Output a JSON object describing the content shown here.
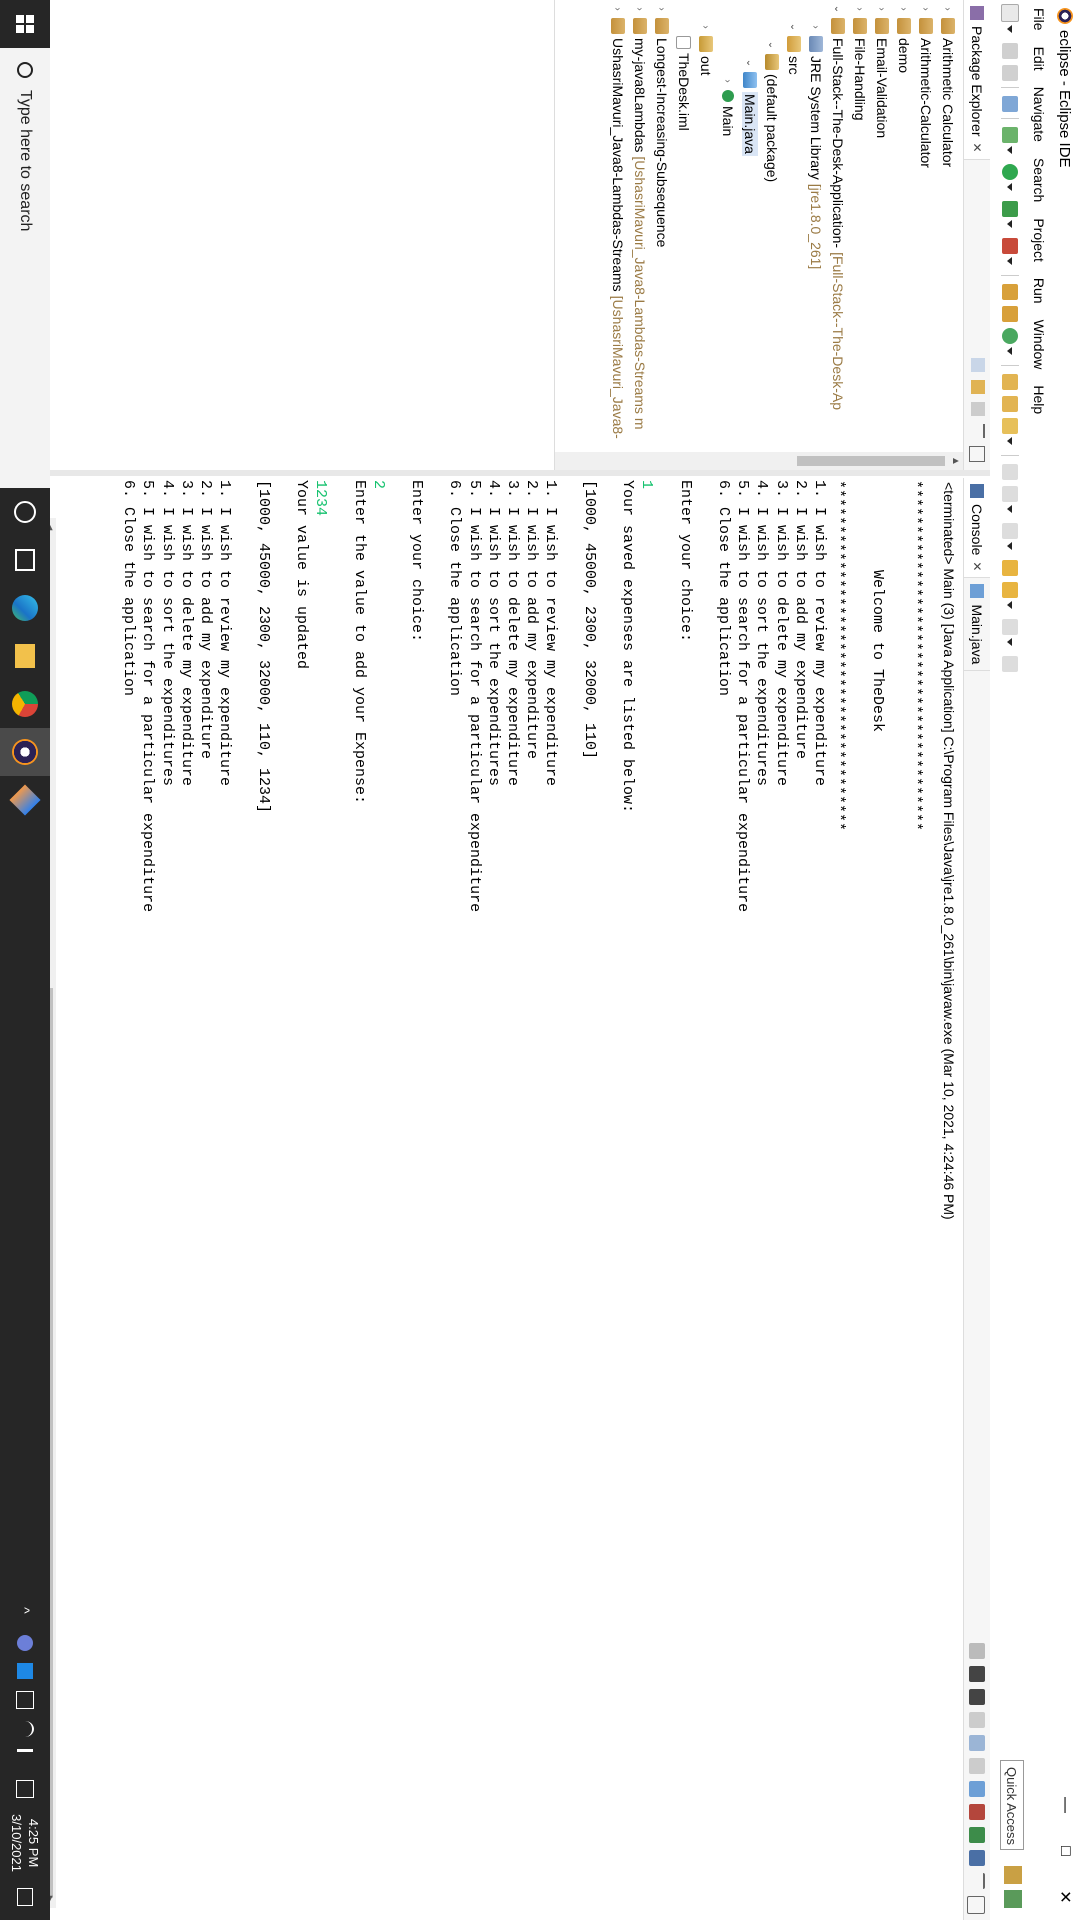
{
  "window": {
    "title": "eclipse - Eclipse IDE",
    "minimize": "—",
    "maximize": "□",
    "close": "✕"
  },
  "menu": [
    "File",
    "Edit",
    "Navigate",
    "Search",
    "Project",
    "Run",
    "Window",
    "Help"
  ],
  "toolbar": {
    "quick_access": "Quick Access"
  },
  "package_explorer": {
    "tab_label": "Package Explorer",
    "items": [
      {
        "label": "Arithmetic Calculator",
        "depth": 0,
        "icon": "project-icon"
      },
      {
        "label": "Arithmetic-Calculator",
        "depth": 0,
        "icon": "project-icon"
      },
      {
        "label": "demo",
        "depth": 0,
        "icon": "project-icon"
      },
      {
        "label": "Email-Validation",
        "depth": 0,
        "icon": "project-icon"
      },
      {
        "label": "File-Handling",
        "depth": 0,
        "icon": "project-icon"
      },
      {
        "label": "Full-Stack--The-Desk-Application-",
        "depth": 0,
        "icon": "project-icon",
        "decoration": "[Full-Stack--The-Desk-Ap"
      },
      {
        "label": "JRE System Library",
        "depth": 1,
        "icon": "library-icon",
        "decoration": "[jre1.8.0_261]"
      },
      {
        "label": "src",
        "depth": 1,
        "icon": "source-folder-icon"
      },
      {
        "label": "(default package)",
        "depth": 2,
        "icon": "package-icon"
      },
      {
        "label": "Main.java",
        "depth": 3,
        "icon": "java-file-icon"
      },
      {
        "label": "Main",
        "depth": 4,
        "icon": "class-icon"
      },
      {
        "label": "out",
        "depth": 1,
        "icon": "folder-icon"
      },
      {
        "label": "TheDesk.iml",
        "depth": 1,
        "icon": "file-icon"
      },
      {
        "label": "Longest-Increasing-Subsequence",
        "depth": 0,
        "icon": "project-icon"
      },
      {
        "label": "my-java8Lambdas",
        "depth": 0,
        "icon": "project-icon",
        "decoration": "[UshasriMavuri_Java8-Lambdas-Streams m"
      },
      {
        "label": "UshasriMavuri_Java8-Lambdas-Streams",
        "depth": 0,
        "icon": "project-icon",
        "decoration": "[UshasriMavuri_Java8-"
      }
    ]
  },
  "console": {
    "tab_label": "Console",
    "secondary_tab": "Main.java",
    "status": "<terminated> Main (3) [Java Application] C:\\Program Files\\Java\\jre1.8.0_261\\bin\\javaw.exe (Mar 10, 2021, 4:24:46 PM)",
    "output": [
      {
        "text": "***************************************",
        "type": "out"
      },
      {
        "text": "",
        "type": "out"
      },
      {
        "text": "          Welcome to TheDesk",
        "type": "out"
      },
      {
        "text": "",
        "type": "out"
      },
      {
        "text": "***************************************",
        "type": "out"
      },
      {
        "text": "1. I wish to review my expenditure",
        "type": "out"
      },
      {
        "text": "2. I wish to add my expenditure",
        "type": "out"
      },
      {
        "text": "3. I wish to delete my expenditure",
        "type": "out"
      },
      {
        "text": "4. I wish to sort the expenditures",
        "type": "out"
      },
      {
        "text": "5. I wish to search for a particular expenditure",
        "type": "out"
      },
      {
        "text": "6. Close the application",
        "type": "out"
      },
      {
        "text": "",
        "type": "out"
      },
      {
        "text": "Enter your choice:",
        "type": "out"
      },
      {
        "text": "",
        "type": "out"
      },
      {
        "text": "1",
        "type": "in"
      },
      {
        "text": "Your saved expenses are listed below:",
        "type": "out"
      },
      {
        "text": "",
        "type": "out"
      },
      {
        "text": "[1000, 45000, 2300, 32000, 110]",
        "type": "out"
      },
      {
        "text": "",
        "type": "out"
      },
      {
        "text": "1. I wish to review my expenditure",
        "type": "out"
      },
      {
        "text": "2. I wish to add my expenditure",
        "type": "out"
      },
      {
        "text": "3. I wish to delete my expenditure",
        "type": "out"
      },
      {
        "text": "4. I wish to sort the expenditures",
        "type": "out"
      },
      {
        "text": "5. I wish to search for a particular expenditure",
        "type": "out"
      },
      {
        "text": "6. Close the application",
        "type": "out"
      },
      {
        "text": "",
        "type": "out"
      },
      {
        "text": "Enter your choice:",
        "type": "out"
      },
      {
        "text": "",
        "type": "out"
      },
      {
        "text": "2",
        "type": "in"
      },
      {
        "text": "Enter the value to add your Expense:",
        "type": "out"
      },
      {
        "text": "",
        "type": "out"
      },
      {
        "text": "1234",
        "type": "in"
      },
      {
        "text": "Your value is updated",
        "type": "out"
      },
      {
        "text": "",
        "type": "out"
      },
      {
        "text": "[1000, 45000, 2300, 32000, 110, 1234]",
        "type": "out"
      },
      {
        "text": "",
        "type": "out"
      },
      {
        "text": "1. I wish to review my expenditure",
        "type": "out"
      },
      {
        "text": "2. I wish to add my expenditure",
        "type": "out"
      },
      {
        "text": "3. I wish to delete my expenditure",
        "type": "out"
      },
      {
        "text": "4. I wish to sort the expenditures",
        "type": "out"
      },
      {
        "text": "5. I wish to search for a particular expenditure",
        "type": "out"
      },
      {
        "text": "6. Close the application",
        "type": "out"
      }
    ]
  },
  "taskbar": {
    "search_placeholder": "Type here to search",
    "time": "4:25 PM",
    "date": "3/10/2021",
    "apps": [
      "cortana-icon",
      "task-view-icon",
      "edge-icon",
      "file-explorer-icon",
      "chrome-icon",
      "eclipse-icon",
      "app-icon"
    ]
  },
  "colors": {
    "console_input": "#17c26f",
    "decoration": "#9a7a44",
    "taskbar": "#262626"
  }
}
